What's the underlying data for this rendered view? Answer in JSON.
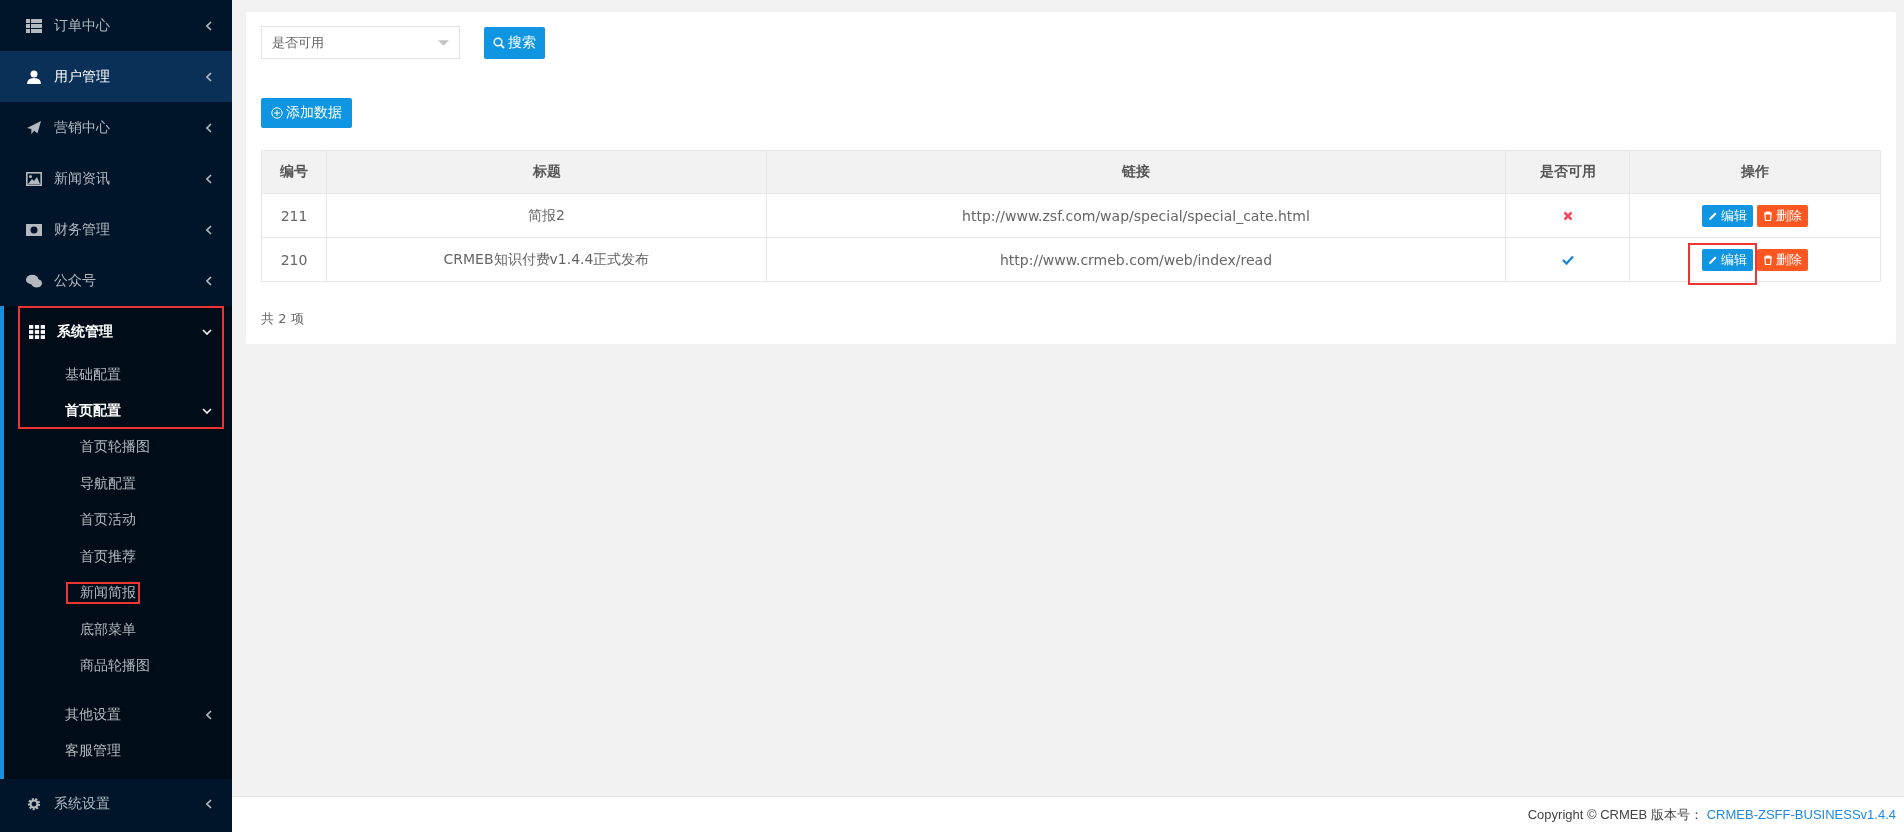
{
  "sidebar": {
    "items": [
      {
        "label": "订单中心",
        "selected": false,
        "expanded": false
      },
      {
        "label": "用户管理",
        "selected": true,
        "expanded": false
      },
      {
        "label": "营销中心",
        "selected": false,
        "expanded": false
      },
      {
        "label": "新闻资讯",
        "selected": false,
        "expanded": false
      },
      {
        "label": "财务管理",
        "selected": false,
        "expanded": false
      },
      {
        "label": "公众号",
        "selected": false,
        "expanded": false
      },
      {
        "label": "系统管理",
        "selected": false,
        "expanded": true,
        "highlighted": true,
        "children": [
          {
            "label": "基础配置",
            "highlighted": true
          },
          {
            "label": "首页配置",
            "expanded": true,
            "highlighted": true,
            "children": [
              {
                "label": "首页轮播图",
                "highlighted": false
              },
              {
                "label": "导航配置",
                "highlighted": false
              },
              {
                "label": "首页活动",
                "highlighted": false
              },
              {
                "label": "首页推荐",
                "highlighted": false
              },
              {
                "label": "新闻简报",
                "highlighted": true
              },
              {
                "label": "底部菜单",
                "highlighted": false
              },
              {
                "label": "商品轮播图",
                "highlighted": false
              }
            ]
          },
          {
            "label": "其他设置",
            "expanded": false,
            "highlighted": false
          },
          {
            "label": "客服管理",
            "highlighted": false
          }
        ]
      },
      {
        "label": "系统设置",
        "selected": false,
        "expanded": false
      }
    ]
  },
  "filter": {
    "placeholder": "是否可用",
    "search_button": "搜索"
  },
  "add_button": "添加数据",
  "table": {
    "columns": [
      "编号",
      "标题",
      "链接",
      "是否可用",
      "操作"
    ],
    "rows": [
      {
        "id": "211",
        "title": "简报2",
        "link": "http://www.zsf.com/wap/special/special_cate.html",
        "enabled": false,
        "actions": [
          {
            "kind": "edit",
            "label": "编辑",
            "highlighted": false
          },
          {
            "kind": "delete",
            "label": "删除",
            "highlighted": false
          }
        ]
      },
      {
        "id": "210",
        "title": "CRMEB知识付费v1.4.4正式发布",
        "link": "http://www.crmeb.com/web/index/read",
        "enabled": true,
        "actions": [
          {
            "kind": "edit",
            "label": "编辑",
            "highlighted": true
          },
          {
            "kind": "delete",
            "label": "删除",
            "highlighted": false
          }
        ]
      }
    ]
  },
  "total": "共 2 项",
  "footer": {
    "text": "Copyright © CRMEB 版本号：",
    "version_link": "CRMEB-ZSFF-BUSINESSv1.4.4"
  }
}
